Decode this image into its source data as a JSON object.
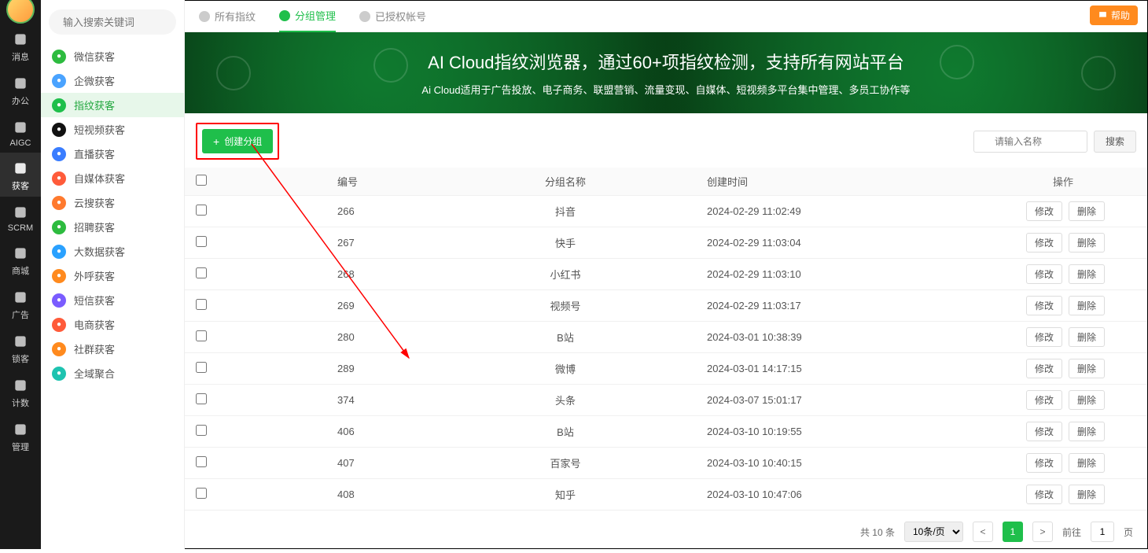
{
  "rail": [
    {
      "label": "消息"
    },
    {
      "label": "办公"
    },
    {
      "label": "AIGC"
    },
    {
      "label": "获客"
    },
    {
      "label": "SCRM"
    },
    {
      "label": "商城"
    },
    {
      "label": "广告"
    },
    {
      "label": "锁客"
    },
    {
      "label": "计数"
    },
    {
      "label": "管理"
    }
  ],
  "search_placeholder": "输入搜索关键词",
  "sidebar": [
    {
      "label": "微信获客",
      "color": "#2dbb3f"
    },
    {
      "label": "企微获客",
      "color": "#4aa3ff"
    },
    {
      "label": "指纹获客",
      "color": "#1fbf4b"
    },
    {
      "label": "短视频获客",
      "color": "#111"
    },
    {
      "label": "直播获客",
      "color": "#3a7dff"
    },
    {
      "label": "自媒体获客",
      "color": "#ff5b3a"
    },
    {
      "label": "云搜获客",
      "color": "#ff7a2e"
    },
    {
      "label": "招聘获客",
      "color": "#2dbb3f"
    },
    {
      "label": "大数据获客",
      "color": "#2aa1ff"
    },
    {
      "label": "外呼获客",
      "color": "#ff8a1e"
    },
    {
      "label": "短信获客",
      "color": "#7a5cff"
    },
    {
      "label": "电商获客",
      "color": "#ff5b3a"
    },
    {
      "label": "社群获客",
      "color": "#ff8a1e"
    },
    {
      "label": "全域聚合",
      "color": "#1ec3b0"
    }
  ],
  "active_sidebar_index": 2,
  "tabs": [
    {
      "label": "所有指纹"
    },
    {
      "label": "分组管理"
    },
    {
      "label": "已授权帐号"
    }
  ],
  "active_tab_index": 1,
  "help_label": "帮助",
  "banner_title": "AI Cloud指纹浏览器，通过60+项指纹检测，支持所有网站平台",
  "banner_sub": "Ai Cloud适用于广告投放、电子商务、联盟营销、流量变现、自媒体、短视频多平台集中管理、多员工协作等",
  "create_label": "创建分组",
  "name_placeholder": "请输入名称",
  "search_btn": "搜索",
  "columns": {
    "id": "编号",
    "name": "分组名称",
    "time": "创建时间",
    "op": "操作"
  },
  "op_labels": {
    "edit": "修改",
    "del": "删除"
  },
  "rows": [
    {
      "id": "266",
      "name": "抖音",
      "time": "2024-02-29 11:02:49"
    },
    {
      "id": "267",
      "name": "快手",
      "time": "2024-02-29 11:03:04"
    },
    {
      "id": "268",
      "name": "小红书",
      "time": "2024-02-29 11:03:10"
    },
    {
      "id": "269",
      "name": "视频号",
      "time": "2024-02-29 11:03:17"
    },
    {
      "id": "280",
      "name": "B站",
      "time": "2024-03-01 10:38:39"
    },
    {
      "id": "289",
      "name": "微博",
      "time": "2024-03-01 14:17:15"
    },
    {
      "id": "374",
      "name": "头条",
      "time": "2024-03-07 15:01:17"
    },
    {
      "id": "406",
      "name": "B站",
      "time": "2024-03-10 10:19:55"
    },
    {
      "id": "407",
      "name": "百家号",
      "time": "2024-03-10 10:40:15"
    },
    {
      "id": "408",
      "name": "知乎",
      "time": "2024-03-10 10:47:06"
    }
  ],
  "pager": {
    "total_text": "共 10 条",
    "per_page": "10条/页",
    "current": "1",
    "goto_label": "前往",
    "goto_value": "1",
    "page_suffix": "页"
  }
}
